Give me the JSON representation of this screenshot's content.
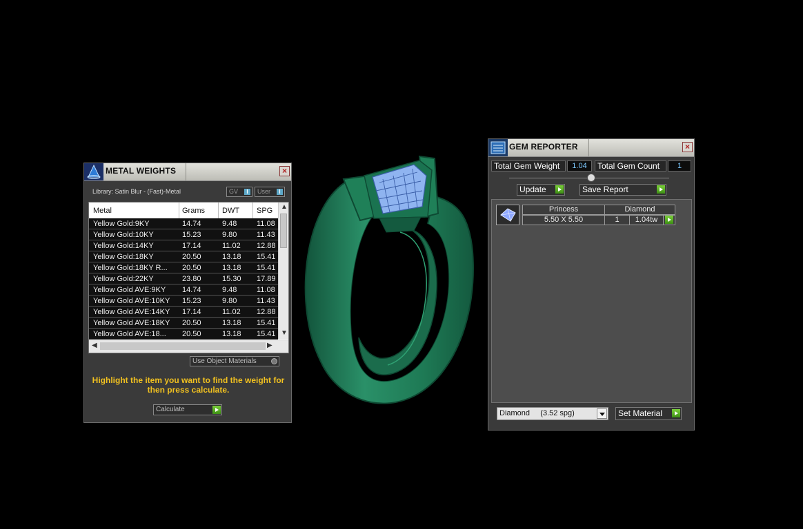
{
  "metal_weights": {
    "title": "METAL WEIGHTS",
    "library_label": "Library: Satin Blur - (Fast)-Metal",
    "toggle_gv": "GV",
    "toggle_user": "User",
    "columns": [
      "Metal",
      "Grams",
      "DWT",
      "SPG"
    ],
    "rows": [
      [
        "Yellow Gold:9KY",
        "14.74",
        "9.48",
        "11.08"
      ],
      [
        "Yellow Gold:10KY",
        "15.23",
        "9.80",
        "11.43"
      ],
      [
        "Yellow Gold:14KY",
        "17.14",
        "11.02",
        "12.88"
      ],
      [
        "Yellow Gold:18KY",
        "20.50",
        "13.18",
        "15.41"
      ],
      [
        "Yellow Gold:18KY R...",
        "20.50",
        "13.18",
        "15.41"
      ],
      [
        "Yellow Gold:22KY",
        "23.80",
        "15.30",
        "17.89"
      ],
      [
        "Yellow Gold AVE:9KY",
        "14.74",
        "9.48",
        "11.08"
      ],
      [
        "Yellow Gold AVE:10KY",
        "15.23",
        "9.80",
        "11.43"
      ],
      [
        "Yellow Gold AVE:14KY",
        "17.14",
        "11.02",
        "12.88"
      ],
      [
        "Yellow Gold AVE:18KY",
        "20.50",
        "13.18",
        "15.41"
      ],
      [
        "Yellow Gold AVE:18...",
        "20.50",
        "13.18",
        "15.41"
      ]
    ],
    "use_object_materials": "Use Object Materials",
    "hint": "Highlight the item you want to find the weight for then press calculate.",
    "calculate_label": "Calculate"
  },
  "gem_reporter": {
    "title": "GEM REPORTER",
    "total_weight_label": "Total Gem Weight",
    "total_weight_value": "1.04",
    "total_count_label": "Total Gem Count",
    "total_count_value": "1",
    "update_label": "Update",
    "save_report_label": "Save Report",
    "gem": {
      "shape": "Princess",
      "material": "Diamond",
      "size": "5.50 X 5.50",
      "count": "1",
      "weight": "1.04tw"
    },
    "material_select": "Diamond     (3.52 spg)",
    "set_material_label": "Set Material"
  },
  "colors": {
    "ring_green": "#1f7a57",
    "gem_blue": "#8fb4f0",
    "hint_yellow": "#f0c020",
    "go_green": "#5cb82a"
  }
}
